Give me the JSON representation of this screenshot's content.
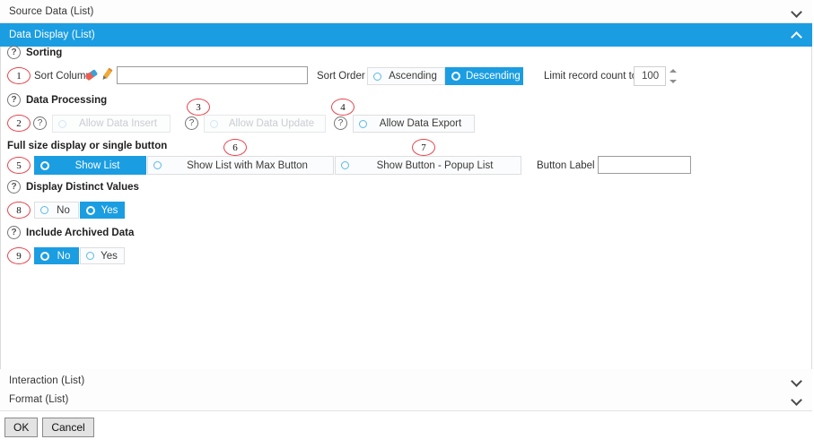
{
  "accordion": {
    "sections": [
      {
        "label": "Source Data (List)",
        "expanded": false,
        "icon": "chevron-down-icon"
      },
      {
        "label": "Data Display (List)",
        "expanded": true,
        "icon": "chevron-up-icon"
      },
      {
        "label": "Interaction (List)",
        "expanded": false,
        "icon": "chevron-down-icon"
      },
      {
        "label": "Format (List)",
        "expanded": false,
        "icon": "chevron-down-icon"
      }
    ]
  },
  "sorting": {
    "title": "Sorting",
    "help_icon": "question-mark-icon",
    "sort_column_label": "Sort Column",
    "sort_column_value": "",
    "eraser_icon": "eraser-icon",
    "pencil_icon": "pencil-icon",
    "sort_order_label": "Sort Order",
    "options": [
      {
        "label": "Ascending",
        "selected": false
      },
      {
        "label": "Descending",
        "selected": true
      }
    ],
    "limit_label": "Limit record count to",
    "limit_value": "100",
    "spinner_icon": "spinner-arrows-icon"
  },
  "data_processing": {
    "title": "Data Processing",
    "help_icon": "question-mark-icon",
    "toggles": [
      {
        "label": "Allow Data Insert",
        "selected": false,
        "disabled": true,
        "help_icon": "question-mark-icon"
      },
      {
        "label": "Allow Data Update",
        "selected": false,
        "disabled": true,
        "help_icon": "question-mark-icon"
      },
      {
        "label": "Allow Data Export",
        "selected": false,
        "disabled": false,
        "help_icon": "question-mark-icon"
      }
    ]
  },
  "display_mode": {
    "title": "Full size display or single button",
    "options": [
      {
        "label": "Show List",
        "selected": true
      },
      {
        "label": "Show List with Max Button",
        "selected": false
      },
      {
        "label": "Show Button - Popup List",
        "selected": false
      }
    ],
    "button_label_label": "Button Label",
    "button_label_value": ""
  },
  "distinct_values": {
    "title": "Display Distinct Values",
    "help_icon": "question-mark-icon",
    "options": [
      {
        "label": "No",
        "selected": false
      },
      {
        "label": "Yes",
        "selected": true
      }
    ]
  },
  "archived_data": {
    "title": "Include Archived Data",
    "help_icon": "question-mark-icon",
    "options": [
      {
        "label": "No",
        "selected": true
      },
      {
        "label": "Yes",
        "selected": false
      }
    ]
  },
  "markers": [
    {
      "number": "1"
    },
    {
      "number": "2"
    },
    {
      "number": "3"
    },
    {
      "number": "4"
    },
    {
      "number": "5"
    },
    {
      "number": "6"
    },
    {
      "number": "7"
    },
    {
      "number": "8"
    },
    {
      "number": "9"
    }
  ],
  "footer": {
    "ok_label": "OK",
    "cancel_label": "Cancel"
  },
  "colors": {
    "accent": "#1b9de2",
    "marker": "#e8444e",
    "radio": "#5bb8ea"
  }
}
